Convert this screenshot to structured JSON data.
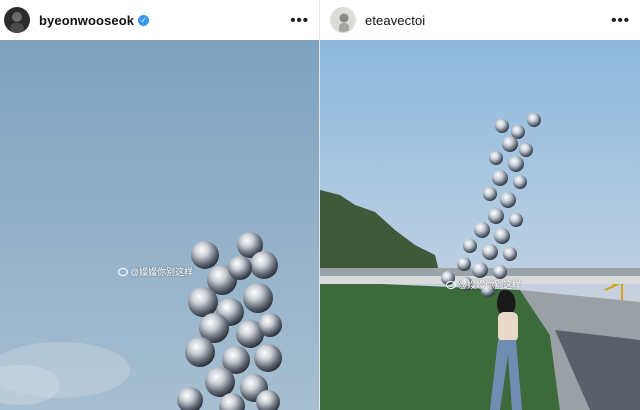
{
  "posts": [
    {
      "username": "byeonwooseok",
      "verified": true,
      "more_label": "•••",
      "watermark": "@嫚嫚你别这样"
    },
    {
      "username": "eteavectoi",
      "verified": false,
      "more_label": "•••",
      "watermark": "@嫚嫚你别这样"
    }
  ],
  "colors": {
    "verified_badge": "#3897f0",
    "sky_left": "#8fb0c9",
    "sky_right": "#9cc0df",
    "lawn": "#3c6a3a"
  },
  "icons": {
    "verified": "verified-check-icon",
    "more": "more-options-icon",
    "watermark": "weibo-logo-icon"
  }
}
